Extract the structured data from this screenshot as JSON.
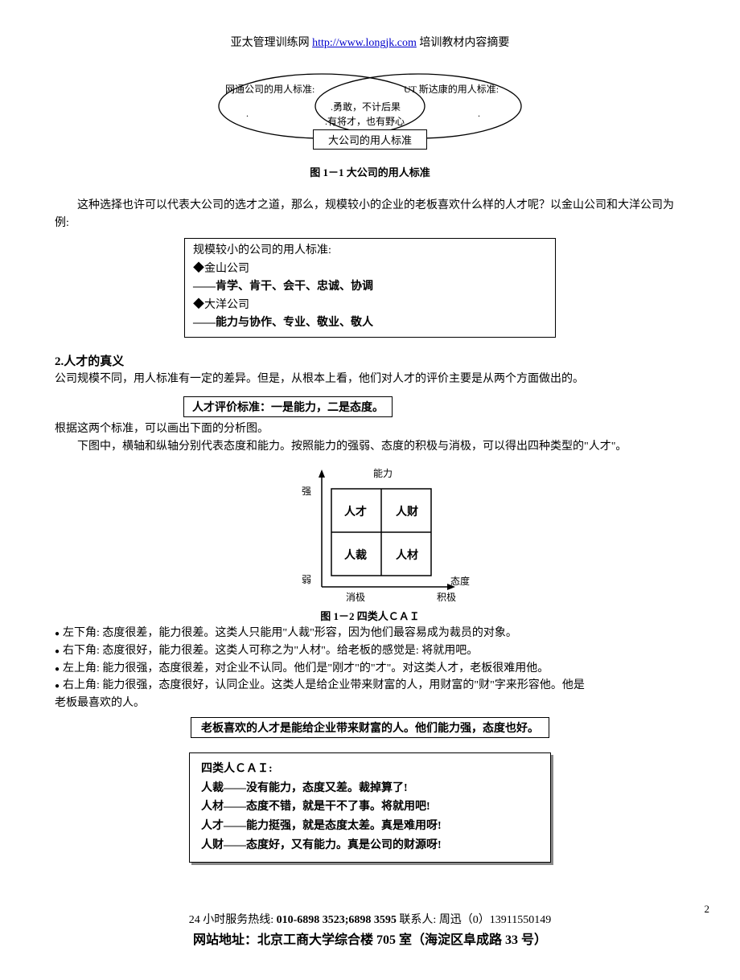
{
  "header": {
    "prefix": "亚太管理训练网",
    "url_text": "http://www.longjk.com",
    "suffix": "  培训教材内容摘要"
  },
  "venn": {
    "left_title": "网通公司的用人标准:",
    "right_title": "UT 斯达康的用人标准:",
    "mid_line1": ".勇敢，不计后果",
    "mid_line2": ".有将才，也有野心",
    "box_label": "大公司的用人标准"
  },
  "fig1_caption": "图 1－1  大公司的用人标准",
  "para1": "这种选择也许可以代表大公司的选才之道，那么，规模较小的企业的老板喜欢什么样的人才呢？以金山公司和大洋公司为例:",
  "small_box": {
    "title": "规模较小的公司的用人标准:",
    "l1": "◆金山公司",
    "l2": "——肯学、肯干、会干、忠诚、协调",
    "l3": "◆大洋公司",
    "l4": "——能力与协作、专业、敬业、敬人"
  },
  "sec2_heading": "2.人才的真义",
  "para2": "公司规模不同，用人标准有一定的差异。但是，从根本上看，他们对人才的评价主要是从两个方面做出的。",
  "criteria_box": "人才评价标准：一是能力，二是态度。",
  "para3": "根据这两个标准，可以画出下面的分析图。",
  "para4": "下图中，横轴和纵轴分别代表态度和能力。按照能力的强弱、态度的积极与消极，可以得出四种类型的\"人才\"。",
  "quadrant": {
    "y_axis": "能力",
    "x_axis": "态度",
    "y_high": "强",
    "y_low": "弱",
    "x_left": "消极",
    "x_right": "积极",
    "q1": "人才",
    "q2": "人财",
    "q3": "人裁",
    "q4": "人材"
  },
  "fig2_caption": "图 1－2  四类人ＣＡＩ",
  "bullets": {
    "b1": "左下角: 态度很差，能力很差。这类人只能用\"人裁\"形容，因为他们最容易成为裁员的对象。",
    "b2": "右下角: 态度很好，能力很差。这类人可称之为\"人材\"。给老板的感觉是: 将就用吧。",
    "b3": "左上角: 能力很强，态度很差，对企业不认同。他们是\"刚才\"的\"才\"。对这类人才，老板很难用他。",
    "b4_a": "右上角: 能力很强，态度很好，认同企业。这类人是给企业带来财富的人，用财富的\"财\"字来形容他。他是",
    "b4_b": "老板最喜欢的人。"
  },
  "highlight": "老板喜欢的人才是能给企业带来财富的人。他们能力强，态度也好。",
  "shadow": {
    "t": "四类人ＣＡＩ:",
    "l1": "人裁——没有能力，态度又差。裁掉算了!",
    "l2": "人材——态度不错，就是干不了事。将就用吧!",
    "l3": "人才——能力挺强，就是态度太差。真是难用呀!",
    "l4": "人财——态度好，又有能力。真是公司的财源呀!"
  },
  "footer": {
    "hotline_label": "24 小时服务热线:",
    "phones": "010-6898 3523;6898 3595",
    "contact_label": " 联系人:",
    "contact_person": "周迅（0）13911550149",
    "address": "网站地址：北京工商大学综合楼 705 室（海淀区阜成路 33 号）"
  },
  "page_number": "2",
  "chart_data": {
    "type": "table",
    "title": "四类人ＣＡＩ",
    "xlabel": "态度",
    "ylabel": "能力",
    "x_categories": [
      "消极",
      "积极"
    ],
    "y_categories": [
      "强",
      "弱"
    ],
    "grid": [
      [
        "人才",
        "人财"
      ],
      [
        "人裁",
        "人材"
      ]
    ]
  }
}
